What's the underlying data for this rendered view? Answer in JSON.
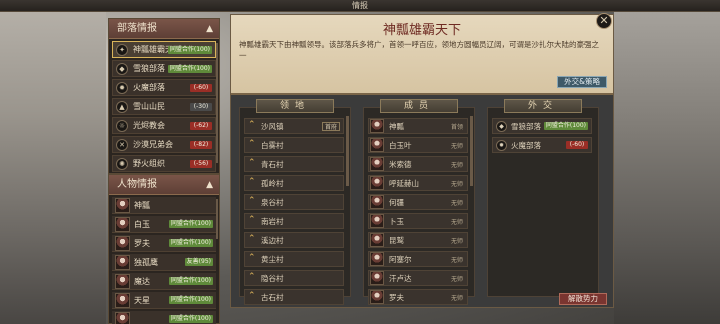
{
  "window": {
    "title": "情报"
  },
  "colors": {
    "friendly": "#5f8a3a",
    "hostile": "#9a2e26",
    "neutral": "#4a4a4a",
    "accent": "#d9b45a"
  },
  "tribes": {
    "header": "部落情报",
    "items": [
      {
        "name": "神瓢雄霸天下",
        "badge": "同盟合作(100)",
        "badge_type": "friendly",
        "icon": "star-icon",
        "selected": true,
        "dot": "●"
      },
      {
        "name": "雪狼部落",
        "badge": "同盟合作(100)",
        "badge_type": "friendly",
        "icon": "wolf-icon"
      },
      {
        "name": "火魔部落",
        "badge": "(-60)",
        "badge_type": "hostile",
        "icon": "fire-icon"
      },
      {
        "name": "雪山山民",
        "badge": "(-30)",
        "badge_type": "neutral",
        "icon": "mountain-icon"
      },
      {
        "name": "光烬教会",
        "badge": "(-62)",
        "badge_type": "hostile",
        "icon": "sun-icon"
      },
      {
        "name": "沙漠兄弟会",
        "badge": "(-82)",
        "badge_type": "hostile",
        "icon": "swords-icon"
      },
      {
        "name": "野火组织",
        "badge": "(-56)",
        "badge_type": "hostile",
        "icon": "flame-icon"
      }
    ]
  },
  "characters": {
    "header": "人物情报",
    "items": [
      {
        "name": "神瓢",
        "badge": ""
      },
      {
        "name": "白玉",
        "badge": "同盟合作(100)",
        "badge_type": "friendly"
      },
      {
        "name": "罗夫",
        "badge": "同盟合作(100)",
        "badge_type": "friendly"
      },
      {
        "name": "独孤鹰",
        "badge": "友善(95)",
        "badge_type": "friendly"
      },
      {
        "name": "魔达",
        "badge": "同盟合作(100)",
        "badge_type": "friendly"
      },
      {
        "name": "天星",
        "badge": "同盟合作(100)",
        "badge_type": "friendly"
      },
      {
        "name": "",
        "badge": "同盟合作(100)",
        "badge_type": "friendly"
      }
    ]
  },
  "main": {
    "title": "神瓢雄霸天下",
    "description": "神瓢雄霸天下由神瓢领导。该部落兵多将广，首领一呼百应，领地方圆幅员辽阔，可谓是沙扎尔大陆的豪强之一",
    "diplomacy_button": "外交&策略",
    "disband_button": "解散势力",
    "close": "✕"
  },
  "territory": {
    "header": "领地",
    "items": [
      {
        "name": "沙风镇",
        "tag": "首府"
      },
      {
        "name": "白雾村"
      },
      {
        "name": "青石村"
      },
      {
        "name": "孤岭村"
      },
      {
        "name": "泉谷村"
      },
      {
        "name": "南岩村"
      },
      {
        "name": "溪边村"
      },
      {
        "name": "黄尘村"
      },
      {
        "name": "隐谷村"
      },
      {
        "name": "古石村"
      }
    ]
  },
  "members": {
    "header": "成员",
    "items": [
      {
        "name": "神瓢",
        "status": "首领"
      },
      {
        "name": "白玉叶",
        "status": "无师"
      },
      {
        "name": "米索德",
        "status": "无师"
      },
      {
        "name": "呼延赫山",
        "status": "无师"
      },
      {
        "name": "何疆",
        "status": "无师"
      },
      {
        "name": "卜玉",
        "status": "无师"
      },
      {
        "name": "昆鹫",
        "status": "无师"
      },
      {
        "name": "阿塞尔",
        "status": "无师"
      },
      {
        "name": "汗卢达",
        "status": "无师"
      },
      {
        "name": "罗夫",
        "status": "无师"
      }
    ]
  },
  "diplomacy": {
    "header": "外交",
    "items": [
      {
        "name": "雪狼部落",
        "badge": "同盟合作(100)",
        "badge_type": "friendly",
        "icon": "wolf-icon"
      },
      {
        "name": "火魔部落",
        "badge": "(-60)",
        "badge_type": "hostile",
        "icon": "fire-icon"
      }
    ]
  }
}
